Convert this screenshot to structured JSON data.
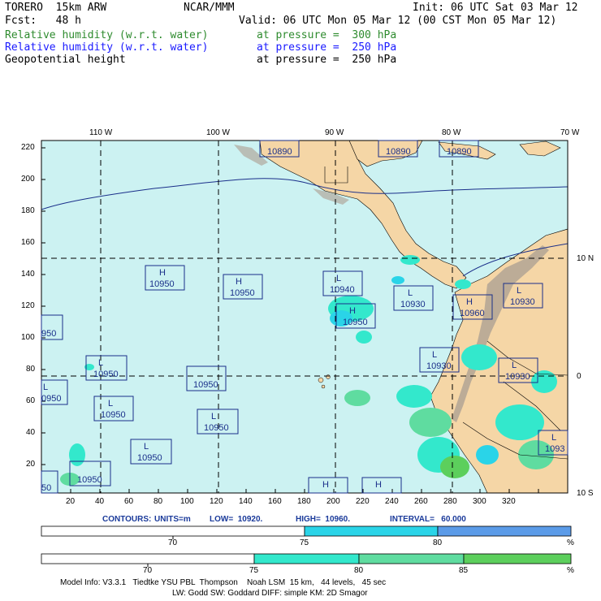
{
  "header": {
    "model": "TORERO  15km ARW",
    "org": "NCAR/MMM",
    "init": "Init: 06 UTC Sat 03 Mar 12",
    "fcst": "Fcst:   48 h",
    "valid": "Valid: 06 UTC Mon 05 Mar 12 (00 CST Mon 05 Mar 12)",
    "fields": [
      {
        "name": "Relative humidity (w.r.t. water)",
        "level": "at pressure =  300 hPa",
        "color": "#2e8b2e"
      },
      {
        "name": "Relative humidity (w.r.t. water)",
        "level": "at pressure =  250 hPa",
        "color": "#1a1aff"
      },
      {
        "name": "Geopotential height",
        "level": "at pressure =  250 hPa",
        "color": "#000000"
      }
    ]
  },
  "map": {
    "ocean_color": "#ccf2f2",
    "land_color": "#f5d6a6",
    "lon_labels": [
      "110 W",
      "100 W",
      "90 W",
      "80 W",
      "70 W"
    ],
    "lat_labels": [
      "10 N",
      "0",
      "10 S"
    ],
    "x_ticks": [
      "20",
      "40",
      "60",
      "80",
      "100",
      "120",
      "140",
      "160",
      "180",
      "200",
      "220",
      "240",
      "260",
      "280",
      "300",
      "320"
    ],
    "y_ticks": [
      "220",
      "200",
      "180",
      "160",
      "140",
      "120",
      "100",
      "80",
      "60",
      "40",
      "20"
    ],
    "centers": [
      {
        "type": "H",
        "value": "10950"
      },
      {
        "type": "H",
        "value": "10950"
      },
      {
        "type": "L",
        "value": "10940"
      },
      {
        "type": "H",
        "value": "10950"
      },
      {
        "type": "L",
        "value": "10930"
      },
      {
        "type": "H",
        "value": "10960"
      },
      {
        "type": "L",
        "value": "10930"
      },
      {
        "type": "L",
        "value": "10930"
      },
      {
        "type": "L",
        "value": "10930"
      },
      {
        "type": "L",
        "value": "10950"
      },
      {
        "type": "",
        "value": "10950"
      },
      {
        "type": "L",
        "value": "10950"
      },
      {
        "type": "L",
        "value": "10950"
      },
      {
        "type": "L",
        "value": "10950"
      },
      {
        "type": "",
        "value": "10950"
      },
      {
        "type": "L",
        "value": "10950"
      },
      {
        "type": "",
        "value": "10890"
      },
      {
        "type": "",
        "value": "10890"
      },
      {
        "type": "",
        "value": "10890"
      },
      {
        "type": "L",
        "value": "1093"
      },
      {
        "type": "",
        "value": "950"
      },
      {
        "type": "L",
        "value": "0950"
      },
      {
        "type": "",
        "value": "50"
      },
      {
        "type": "H",
        "value": ""
      },
      {
        "type": "H",
        "value": ""
      }
    ]
  },
  "contours": {
    "label": "CONTOURS:",
    "units": "UNITS=m",
    "low": "LOW=  10920.",
    "high": "HIGH=  10960.",
    "interval": "INTERVAL=   60.000"
  },
  "colorbar_250": {
    "labels": [
      "70",
      "75",
      "80"
    ],
    "unit": "%",
    "colors": [
      "#ffffff",
      "#2ad4e8",
      "#5b9be8"
    ]
  },
  "colorbar_300": {
    "labels": [
      "70",
      "75",
      "80",
      "85"
    ],
    "unit": "%",
    "colors": [
      "#ffffff",
      "#33e8cc",
      "#5fdca0",
      "#5ccf5c"
    ]
  },
  "footer": {
    "line1": "Model Info: V3.3.1   Tiedtke YSU PBL  Thompson    Noah LSM  15 km,   44 levels,   45 sec",
    "line2": "LW: Godd SW: Goddard DIFF: simple KM: 2D Smagor"
  }
}
